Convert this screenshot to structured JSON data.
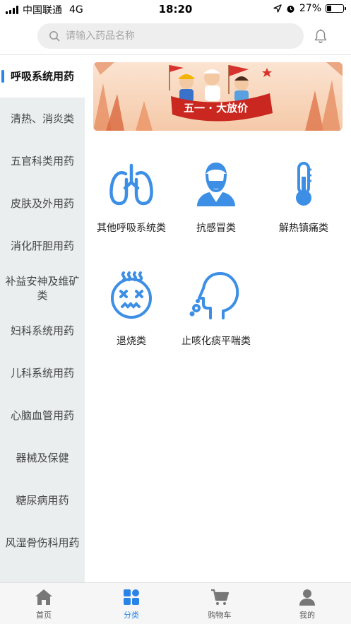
{
  "status_bar": {
    "carrier": "中国联通",
    "network": "4G",
    "time": "18:20",
    "battery": "27%",
    "battery_level": 0.27
  },
  "search": {
    "placeholder": "请输入药品名称"
  },
  "sidebar": {
    "items": [
      {
        "label": "呼吸系统用药",
        "active": true
      },
      {
        "label": "清热、消炎类"
      },
      {
        "label": "五官科类用药"
      },
      {
        "label": "皮肤及外用药"
      },
      {
        "label": "消化肝胆用药"
      },
      {
        "label": "补益安神及维矿类"
      },
      {
        "label": "妇科系统用药"
      },
      {
        "label": "儿科系统用药"
      },
      {
        "label": "心脑血管用药"
      },
      {
        "label": "器械及保健"
      },
      {
        "label": "糖尿病用药"
      },
      {
        "label": "风湿骨伤科用药"
      }
    ]
  },
  "categories": [
    {
      "label": "其他呼吸系统类",
      "icon": "lungs-icon"
    },
    {
      "label": "抗感冒类",
      "icon": "masked-person-icon"
    },
    {
      "label": "解热镇痛类",
      "icon": "thermometer-icon"
    },
    {
      "label": "退烧类",
      "icon": "fever-face-icon"
    },
    {
      "label": "止咳化痰平喘类",
      "icon": "cough-head-icon"
    }
  ],
  "bottom_nav": {
    "items": [
      {
        "label": "首页",
        "icon": "home-icon"
      },
      {
        "label": "分类",
        "icon": "category-icon",
        "active": true
      },
      {
        "label": "购物车",
        "icon": "cart-icon"
      },
      {
        "label": "我的",
        "icon": "user-icon"
      }
    ]
  },
  "colors": {
    "accent": "#2a84e8",
    "icon_blue": "#3d8fe6",
    "sidebar_bg": "#eaeeef"
  }
}
